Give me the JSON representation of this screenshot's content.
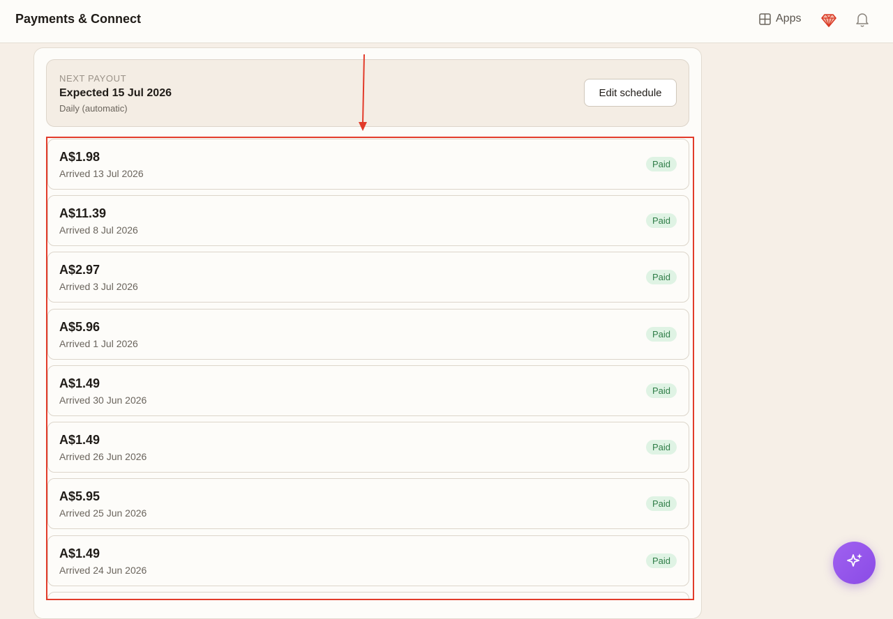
{
  "header": {
    "title": "Payments & Connect",
    "apps_label": "Apps",
    "icons": [
      "grid-icon",
      "gem-icon",
      "bell-icon"
    ]
  },
  "next_payout": {
    "label": "NEXT PAYOUT",
    "expected": "Expected 15 Jul 2026",
    "schedule": "Daily (automatic)",
    "edit_button": "Edit schedule"
  },
  "payouts": [
    {
      "amount": "A$1.98",
      "arrived": "Arrived 13 Jul 2026",
      "status": "Paid"
    },
    {
      "amount": "A$11.39",
      "arrived": "Arrived 8 Jul 2026",
      "status": "Paid"
    },
    {
      "amount": "A$2.97",
      "arrived": "Arrived 3 Jul 2026",
      "status": "Paid"
    },
    {
      "amount": "A$5.96",
      "arrived": "Arrived 1 Jul 2026",
      "status": "Paid"
    },
    {
      "amount": "A$1.49",
      "arrived": "Arrived 30 Jun 2026",
      "status": "Paid"
    },
    {
      "amount": "A$1.49",
      "arrived": "Arrived 26 Jun 2026",
      "status": "Paid"
    },
    {
      "amount": "A$5.95",
      "arrived": "Arrived 25 Jun 2026",
      "status": "Paid"
    },
    {
      "amount": "A$1.49",
      "arrived": "Arrived 24 Jun 2026",
      "status": "Paid"
    }
  ],
  "colors": {
    "background": "#f6efe7",
    "highlight": "#e23b2a",
    "paid_badge_bg": "#dff3e4",
    "paid_badge_text": "#2f7d47",
    "fab": "#9b5cf0"
  },
  "fab": {
    "icon": "sparkle-icon"
  }
}
